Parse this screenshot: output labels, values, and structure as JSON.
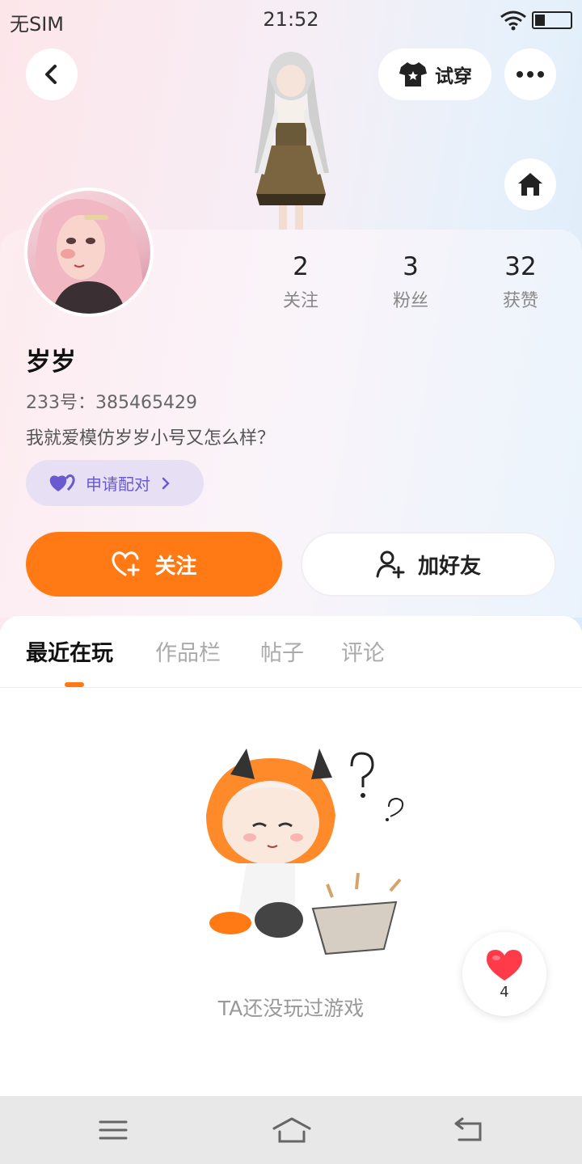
{
  "status_bar": {
    "carrier": "无SIM",
    "time": "21:52"
  },
  "header": {
    "try_on_label": "试穿"
  },
  "profile": {
    "username": "岁岁",
    "uid_text": "233号：385465429",
    "bio": "我就爱模仿岁岁小号又怎么样？",
    "pair_label": "申请配对",
    "stats": [
      {
        "value": "2",
        "label": "关注"
      },
      {
        "value": "3",
        "label": "粉丝"
      },
      {
        "value": "32",
        "label": "获赞"
      }
    ]
  },
  "actions": {
    "follow_label": "关注",
    "add_friend_label": "加好友"
  },
  "tabs": [
    {
      "label": "最近在玩",
      "active": true
    },
    {
      "label": "作品栏",
      "active": false
    },
    {
      "label": "帖子",
      "active": false
    },
    {
      "label": "评论",
      "active": false
    }
  ],
  "empty_state": {
    "text": "TA还没玩过游戏"
  },
  "like_float": {
    "count": "4"
  },
  "colors": {
    "accent": "#ff7a14",
    "pair_bg": "#e7e0f5",
    "pair_text": "#6a5ad0",
    "like_red": "#ff3b4a"
  },
  "icons": {
    "back": "chevron-left-icon",
    "try_on": "shirt-icon",
    "more": "more-dots-icon",
    "home": "home-icon",
    "pair": "heart-pair-icon",
    "follow": "heart-plus-icon",
    "add_friend": "person-add-icon",
    "like": "heart-icon"
  }
}
